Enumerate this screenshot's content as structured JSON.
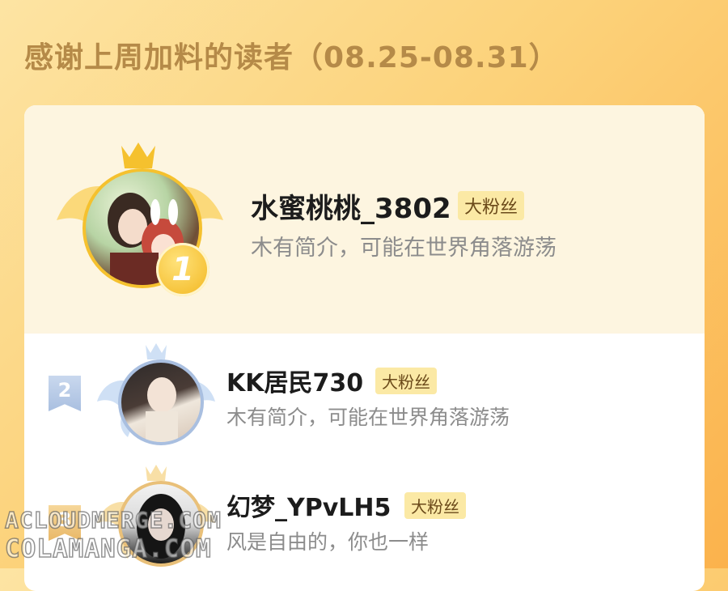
{
  "header": {
    "title": "感谢上周加料的读者（08.25-08.31）"
  },
  "readers": [
    {
      "rank": "1",
      "name": "水蜜桃桃_3802",
      "badge": "大粉丝",
      "bio": "木有简介，可能在世界角落游荡"
    },
    {
      "rank": "2",
      "name": "KK居民730",
      "badge": "大粉丝",
      "bio": "木有简介，可能在世界角落游荡"
    },
    {
      "rank": "3",
      "name": "幻梦_YPvLH5",
      "badge": "大粉丝",
      "bio": "风是自由的，你也一样"
    }
  ],
  "watermark": {
    "line1": "ACLOUDMERGE.COM",
    "line2": "COLAMANGA.COM"
  },
  "colors": {
    "gold": "#f5c12e",
    "badge_bg": "#fbe9a5",
    "title": "#b58a48",
    "silver": "#a9bfe0"
  }
}
